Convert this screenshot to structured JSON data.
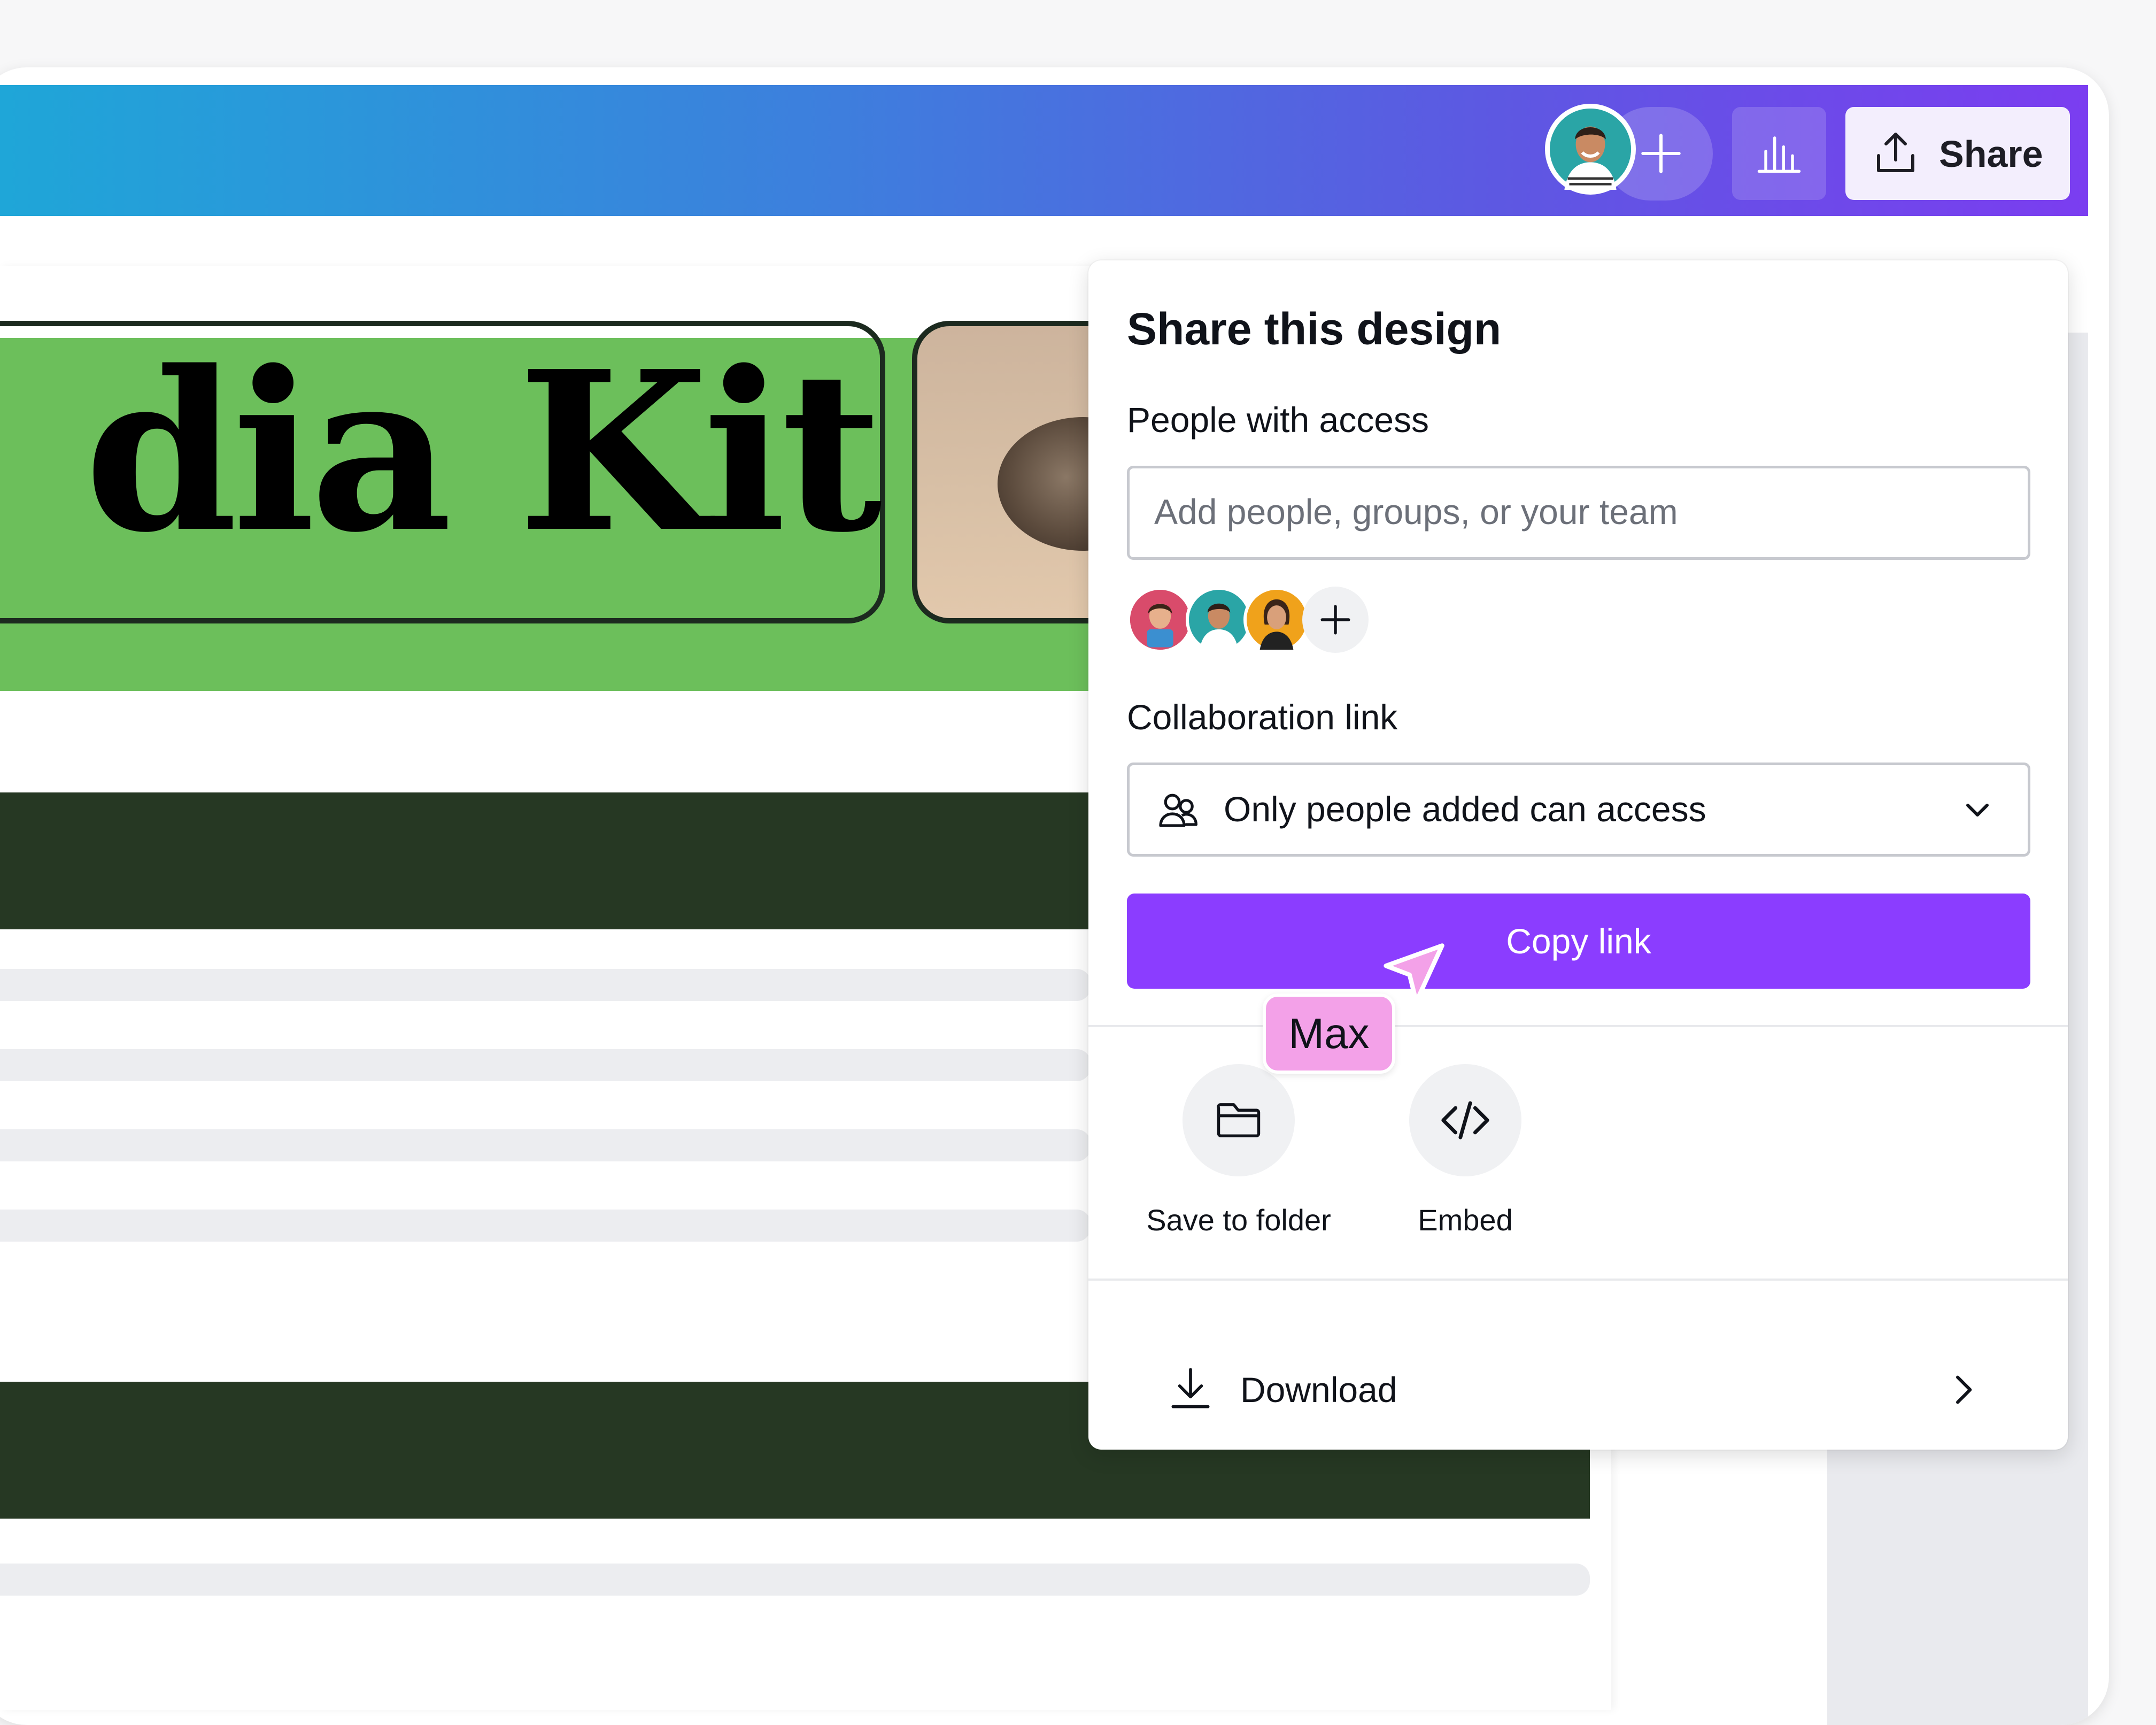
{
  "canvas": {
    "title": "dia Kit",
    "colors": {
      "green": "#6cbf5b",
      "dark_bar": "#263823",
      "line": "#ecedf0"
    }
  },
  "topbar": {
    "gradient_start": "#1ea7d8",
    "gradient_end": "#7b3df0",
    "add_collaborator_icon": "plus-icon",
    "insights_icon": "bar-chart-icon",
    "share_label": "Share",
    "share_icon": "upload-icon"
  },
  "share_panel": {
    "title": "Share this design",
    "people_label": "People with access",
    "people_input_placeholder": "Add people, groups, or your team",
    "add_person_icon": "plus-icon",
    "collab_label": "Collaboration link",
    "access_value": "Only people added can access",
    "access_icon": "people-icon",
    "copy_link_label": "Copy link",
    "actions": [
      {
        "label": "Save to folder",
        "icon": "folder-icon"
      },
      {
        "label": "Embed",
        "icon": "code-icon"
      }
    ],
    "download_label": "Download",
    "accent": "#8b3dff"
  },
  "cursor": {
    "name": "Max",
    "color": "#f3a1e8"
  }
}
